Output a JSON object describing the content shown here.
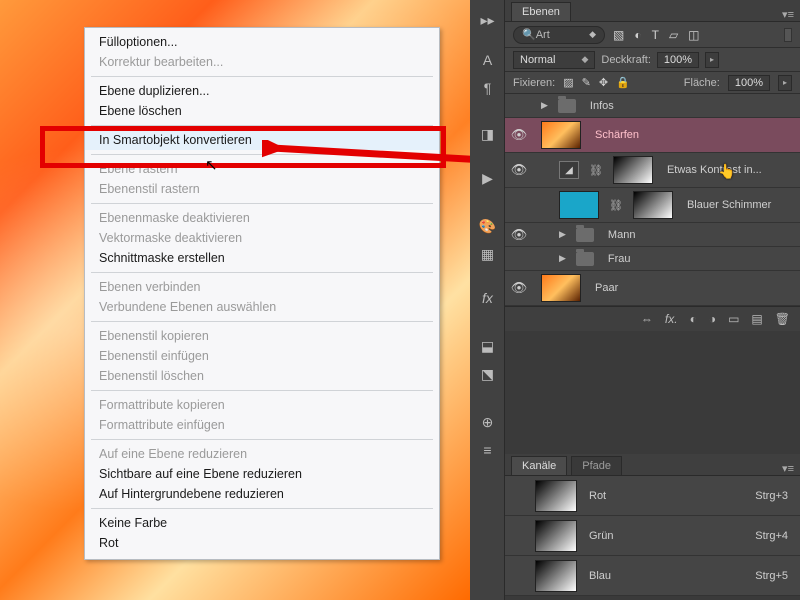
{
  "context_menu": {
    "items": [
      {
        "label": "Fülloptionen...",
        "disabled": false
      },
      {
        "label": "Korrektur bearbeiten...",
        "disabled": true
      },
      {
        "sep": true
      },
      {
        "label": "Ebene duplizieren...",
        "disabled": false
      },
      {
        "label": "Ebene löschen",
        "disabled": false
      },
      {
        "sep": true
      },
      {
        "label": "In Smartobjekt konvertieren",
        "disabled": false,
        "hover": true
      },
      {
        "sep": true
      },
      {
        "label": "Ebene rastern",
        "disabled": true
      },
      {
        "label": "Ebenenstil rastern",
        "disabled": true
      },
      {
        "sep": true
      },
      {
        "label": "Ebenenmaske deaktivieren",
        "disabled": true
      },
      {
        "label": "Vektormaske deaktivieren",
        "disabled": true
      },
      {
        "label": "Schnittmaske erstellen",
        "disabled": false
      },
      {
        "sep": true
      },
      {
        "label": "Ebenen verbinden",
        "disabled": true
      },
      {
        "label": "Verbundene Ebenen auswählen",
        "disabled": true
      },
      {
        "sep": true
      },
      {
        "label": "Ebenenstil kopieren",
        "disabled": true
      },
      {
        "label": "Ebenenstil einfügen",
        "disabled": true
      },
      {
        "label": "Ebenenstil löschen",
        "disabled": true
      },
      {
        "sep": true
      },
      {
        "label": "Formattribute kopieren",
        "disabled": true
      },
      {
        "label": "Formattribute einfügen",
        "disabled": true
      },
      {
        "sep": true
      },
      {
        "label": "Auf eine Ebene reduzieren",
        "disabled": true
      },
      {
        "label": "Sichtbare auf eine Ebene reduzieren",
        "disabled": false
      },
      {
        "label": "Auf Hintergrundebene reduzieren",
        "disabled": false
      },
      {
        "sep": true
      },
      {
        "label": "Keine Farbe",
        "disabled": false
      },
      {
        "label": "Rot",
        "disabled": false
      }
    ]
  },
  "panels": {
    "layers_tab": "Ebenen",
    "search_label": "Art",
    "blend_mode": "Normal",
    "opacity_label": "Deckkraft:",
    "opacity_value": "100%",
    "lock_label": "Fixieren:",
    "fill_label": "Fläche:",
    "fill_value": "100%",
    "layers": [
      {
        "type": "group",
        "name": "Infos",
        "visible": false,
        "indent": 0
      },
      {
        "type": "layer",
        "name": "Schärfen",
        "visible": true,
        "indent": 0,
        "thumb": "fire",
        "selected": true
      },
      {
        "type": "adjust",
        "name": "Etwas Kontrast in...",
        "visible": true,
        "indent": 1,
        "mask": true
      },
      {
        "type": "mask",
        "name": "Blauer Schimmer",
        "visible": false,
        "indent": 1,
        "thumb": "blue",
        "mask": true
      },
      {
        "type": "group",
        "name": "Mann",
        "visible": true,
        "indent": 1
      },
      {
        "type": "group",
        "name": "Frau",
        "visible": false,
        "indent": 1
      },
      {
        "type": "layer",
        "name": "Paar",
        "visible": true,
        "indent": 0,
        "thumb": "fire"
      }
    ],
    "channels_tab": "Kanäle",
    "paths_tab": "Pfade",
    "channels": [
      {
        "name": "Rot",
        "shortcut": "Strg+3"
      },
      {
        "name": "Grün",
        "shortcut": "Strg+4"
      },
      {
        "name": "Blau",
        "shortcut": "Strg+5"
      }
    ]
  }
}
